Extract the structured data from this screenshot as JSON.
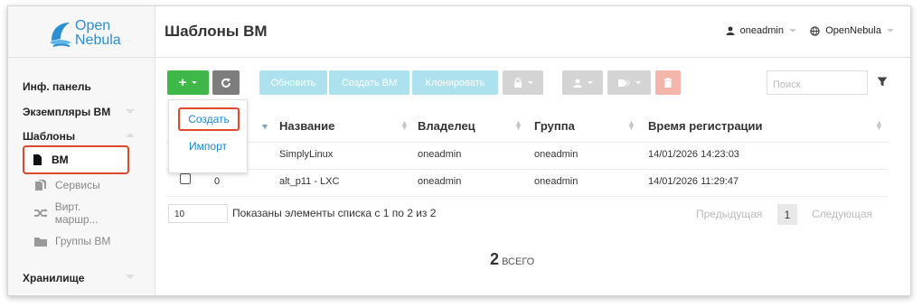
{
  "logo": {
    "line1": "Open",
    "line2": "Nebula"
  },
  "sidebar": {
    "items": [
      {
        "label": "Инф. панель"
      },
      {
        "label": "Экземпляры ВМ"
      },
      {
        "label": "Шаблоны"
      },
      {
        "label": "Хранилище"
      }
    ],
    "templates_sub": [
      {
        "label": "ВМ",
        "icon": "file-icon",
        "active": true
      },
      {
        "label": "Сервисы",
        "icon": "files-icon",
        "active": false
      },
      {
        "label": "Вирт. маршр...",
        "icon": "shuffle-icon",
        "active": false
      },
      {
        "label": "Группы ВМ",
        "icon": "folder-icon",
        "active": false
      }
    ]
  },
  "header": {
    "title": "Шаблоны ВМ",
    "user": "oneadmin",
    "zone": "OpenNebula"
  },
  "toolbar": {
    "add_label": "+",
    "refresh_icon": "refresh-icon",
    "update_label": "Обновить",
    "create_vm_label": "Создать ВМ",
    "clone_label": "Клонировать",
    "search_placeholder": "Поиск"
  },
  "dropdown": {
    "create_label": "Создать",
    "import_label": "Импорт"
  },
  "table": {
    "columns": [
      "Название",
      "Владелец",
      "Группа",
      "Время регистрации"
    ],
    "rows": [
      {
        "id": "",
        "name": "SimplyLinux",
        "owner": "oneadmin",
        "group": "oneadmin",
        "time": "14/01/2026 14:23:03"
      },
      {
        "id": "0",
        "name": "alt_p11 - LXC",
        "owner": "oneadmin",
        "group": "oneadmin",
        "time": "14/01/2026 11:29:47"
      }
    ]
  },
  "pagination": {
    "page_size": "10",
    "showing": "Показаны элементы списка с 1 по 2 из 2",
    "prev": "Предыдущая",
    "page": "1",
    "next": "Следующая"
  },
  "total": {
    "count": "2",
    "label": "ВСЕГО"
  },
  "colors": {
    "accent_green": "#3fb84a",
    "brand_blue": "#2b8fd1",
    "highlight_red": "#e0472f"
  }
}
